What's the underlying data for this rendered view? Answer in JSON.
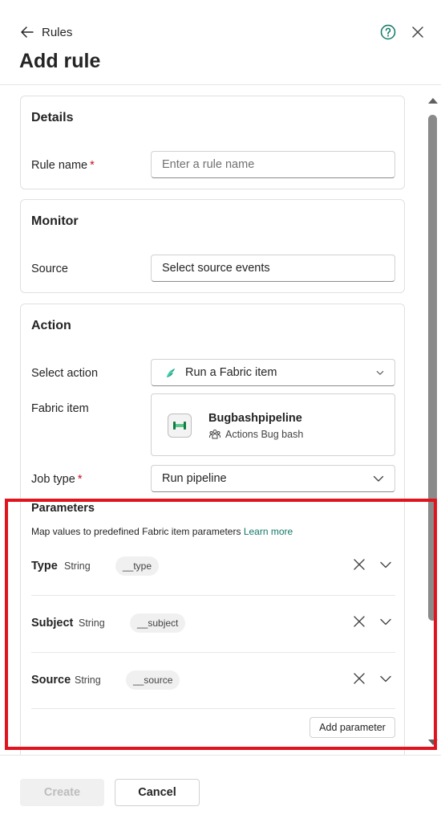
{
  "header": {
    "back_label": "Rules",
    "title": "Add rule"
  },
  "details": {
    "title": "Details",
    "rule_name_label": "Rule name",
    "required_mark": "*",
    "rule_name_placeholder": "Enter a rule name"
  },
  "monitor": {
    "title": "Monitor",
    "source_label": "Source",
    "source_value": "Select source events"
  },
  "action": {
    "title": "Action",
    "select_action_label": "Select action",
    "select_action_value": "Run a Fabric item",
    "fabric_item_label": "Fabric item",
    "fabric_item_name": "Bugbashpipeline",
    "fabric_item_workspace": "Actions Bug bash",
    "job_type_label": "Job type",
    "job_type_value": "Run pipeline"
  },
  "parameters": {
    "title": "Parameters",
    "description": "Map values to predefined Fabric item parameters",
    "learn_more": "Learn more",
    "items": [
      {
        "name": "Type",
        "type": "String",
        "value": "__type"
      },
      {
        "name": "Subject",
        "type": "String",
        "value": "__subject"
      },
      {
        "name": "Source",
        "type": "String",
        "value": "__source"
      }
    ],
    "add_label": "Add parameter"
  },
  "footer": {
    "create_label": "Create",
    "cancel_label": "Cancel"
  },
  "colors": {
    "accent": "#117865",
    "required": "#c50f1f",
    "highlight": "#e0141e"
  }
}
